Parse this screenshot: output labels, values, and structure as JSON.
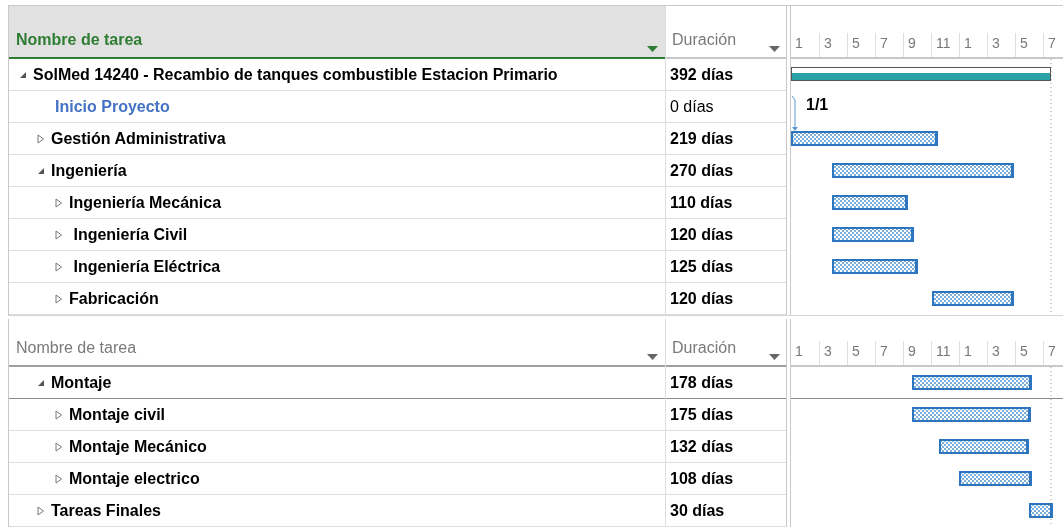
{
  "panes": [
    {
      "header": {
        "name_column": "Nombre de tarea",
        "duration_column": "Duración",
        "selected": true
      },
      "timescale": [
        "1",
        "3",
        "5",
        "7",
        "9",
        "11",
        "1",
        "3",
        "5",
        "7"
      ],
      "rows": [
        {
          "name": "SolMed 14240 - Recambio de tanques combustible Estacion Primario",
          "duration": "392 días",
          "kind": "summary",
          "expanded": true,
          "children": [
            {
              "name": "Inicio Proyecto",
              "duration": "0 días",
              "kind": "milestone",
              "date_label": "1/1"
            },
            {
              "name": "Gestión Administrativa",
              "duration": "219 días",
              "kind": "summary",
              "expanded": false
            },
            {
              "name": "Ingeniería",
              "duration": "270 días",
              "kind": "summary",
              "expanded": true,
              "children": [
                {
                  "name": "Ingeniería Mecánica",
                  "duration": "110 días",
                  "kind": "summary",
                  "expanded": false
                },
                {
                  "name": " Ingeniería Civil",
                  "duration": "120 días",
                  "kind": "summary",
                  "expanded": false
                },
                {
                  "name": " Ingeniería Eléctrica",
                  "duration": "125 días",
                  "kind": "summary",
                  "expanded": false
                },
                {
                  "name": "Fabricación",
                  "duration": "120 días",
                  "kind": "summary",
                  "expanded": false
                }
              ]
            }
          ]
        }
      ]
    },
    {
      "header": {
        "name_column": "Nombre de tarea",
        "duration_column": "Duración",
        "selected": false
      },
      "timescale": [
        "1",
        "3",
        "5",
        "7",
        "9",
        "11",
        "1",
        "3",
        "5",
        "7"
      ],
      "rows": [
        {
          "name": "Montaje",
          "duration": "178 días",
          "kind": "summary",
          "expanded": true,
          "children": [
            {
              "name": "Montaje civil",
              "duration": "175 días",
              "kind": "summary",
              "expanded": false
            },
            {
              "name": "Montaje Mecánico",
              "duration": "132 días",
              "kind": "summary",
              "expanded": false
            },
            {
              "name": "Montaje electrico",
              "duration": "108 días",
              "kind": "summary",
              "expanded": false
            }
          ]
        },
        {
          "name": "Tareas Finales",
          "duration": "30 días",
          "kind": "summary",
          "expanded": false
        }
      ]
    }
  ]
}
